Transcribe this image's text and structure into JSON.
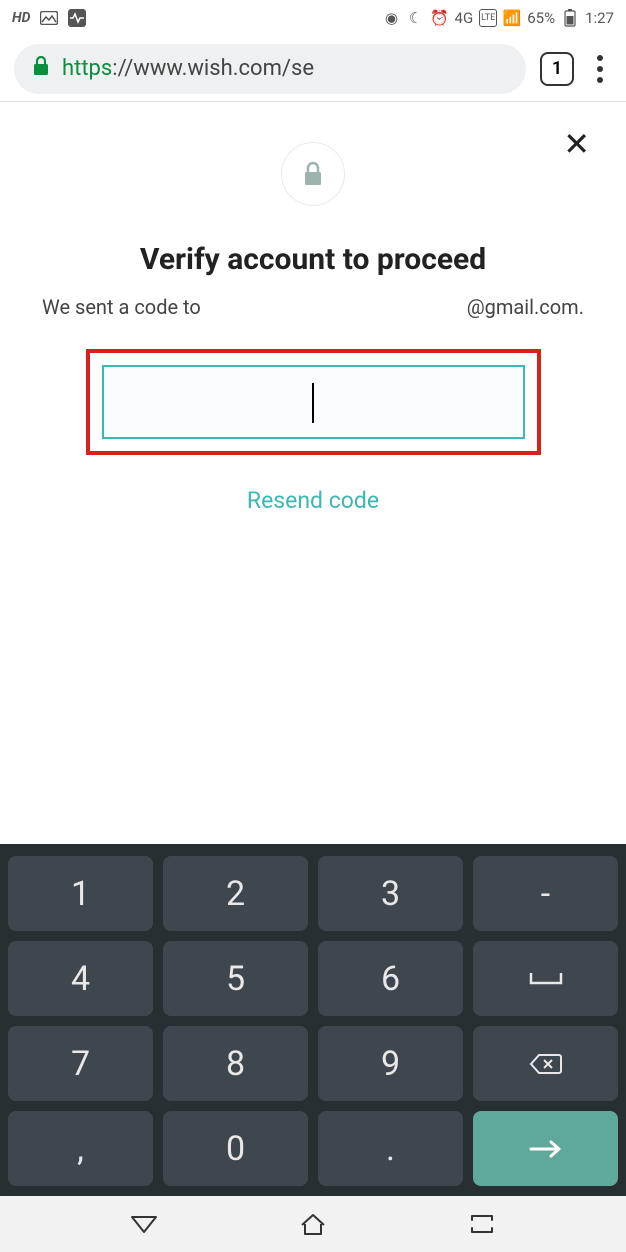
{
  "status_bar": {
    "hd_label": "HD",
    "network_label": "4G",
    "lte_label": "LTE",
    "battery_percent": "65%",
    "time": "1:27"
  },
  "browser": {
    "url_scheme": "https",
    "url_rest": "://www.wish.com/se",
    "tab_count": "1"
  },
  "page": {
    "title": "Verify account to proceed",
    "subtitle_prefix": "We sent a code to",
    "subtitle_suffix": "@gmail.com.",
    "code_input_value": "",
    "resend_label": "Resend code"
  },
  "keyboard": {
    "rows": [
      [
        "1",
        "2",
        "3",
        "-"
      ],
      [
        "4",
        "5",
        "6",
        "␣"
      ],
      [
        "7",
        "8",
        "9",
        "⌫"
      ],
      [
        ",",
        "0",
        ".",
        "→"
      ]
    ]
  }
}
